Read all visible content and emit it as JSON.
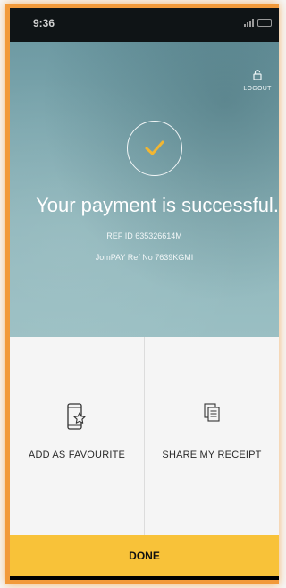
{
  "status_bar": {
    "time": "9:36"
  },
  "header": {
    "logout_label": "LOGOUT",
    "logout_icon": "lock-icon"
  },
  "payment": {
    "status_icon": "checkmark-icon",
    "title": "Your payment is successful.",
    "ref_id": "REF ID 635326614M",
    "jompay_ref": "JomPAY Ref No 7639KGMI"
  },
  "actions": [
    {
      "label": "ADD AS FAVOURITE",
      "icon": "phone-star-icon"
    },
    {
      "label": "SHARE MY RECEIPT",
      "icon": "receipt-icon"
    }
  ],
  "footer": {
    "done_label": "DONE"
  },
  "colors": {
    "accent": "#f8c239",
    "check": "#f2b632",
    "hero": "#7fa9b0",
    "frame_highlight": "#f29a3b"
  }
}
